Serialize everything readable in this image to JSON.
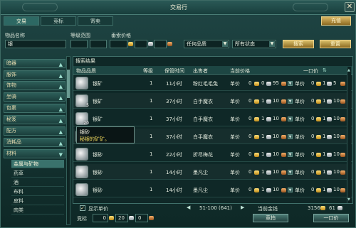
{
  "window": {
    "title": "交易行",
    "close_glyph": "✕"
  },
  "tabs": [
    {
      "label": "交易"
    },
    {
      "label": "竞标"
    },
    {
      "label": "寄卖"
    }
  ],
  "recharge_label": "充值",
  "filters": {
    "name_label": "物品名称",
    "name_value": "银",
    "level_label": "等级范围",
    "price_label": "垂索价格",
    "quality_value": "任何品质",
    "status_value": "所有状态",
    "search_label": "搜索",
    "reset_label": "重置"
  },
  "categories": [
    {
      "label": "暗器"
    },
    {
      "label": "服饰"
    },
    {
      "label": "饰物"
    },
    {
      "label": "坐骑"
    },
    {
      "label": "包裹"
    },
    {
      "label": "秘笈"
    },
    {
      "label": "配方"
    },
    {
      "label": "消耗品"
    },
    {
      "label": "材料"
    }
  ],
  "subcategories": [
    {
      "label": "金属与矿物"
    },
    {
      "label": "药草"
    },
    {
      "label": "酒"
    },
    {
      "label": "布料"
    },
    {
      "label": "皮料"
    },
    {
      "label": "肉类"
    }
  ],
  "results": {
    "caption": "搜索结果",
    "headers": {
      "quality": "物品品质",
      "level": "等级",
      "time": "保管时间",
      "seller": "出售者",
      "price": "当前价格",
      "buyout": "一口价"
    },
    "rows": [
      {
        "name": "银矿",
        "qty": "",
        "level": "1",
        "time": "11小时",
        "seller": "粉红毛毛兔",
        "unit": "单价",
        "p_g": "0",
        "p_s": "0",
        "p_c": "95",
        "b_g": "0",
        "b_s": "1",
        "b_c": "5"
      },
      {
        "name": "银矿",
        "qty": "5",
        "level": "1",
        "time": "37小时",
        "seller": "白手魔衣",
        "unit": "单价",
        "p_g": "0",
        "p_s": "1",
        "p_c": "10",
        "b_g": "0",
        "b_s": "1",
        "b_c": "10"
      },
      {
        "name": "银矿",
        "qty": "20",
        "level": "1",
        "time": "37小时",
        "seller": "白手魔衣",
        "unit": "单价",
        "p_g": "0",
        "p_s": "1",
        "p_c": "10",
        "b_g": "0",
        "b_s": "1",
        "b_c": "10"
      },
      {
        "name": "银矿",
        "qty": "20",
        "level": "1",
        "time": "37小时",
        "seller": "白手魔衣",
        "unit": "单价",
        "p_g": "0",
        "p_s": "1",
        "p_c": "10",
        "b_g": "0",
        "b_s": "1",
        "b_c": "10"
      },
      {
        "name": "银砂",
        "qty": "",
        "level": "1",
        "time": "22小时",
        "seller": "折尽梅花",
        "unit": "单价",
        "p_g": "0",
        "p_s": "1",
        "p_c": "10",
        "b_g": "0",
        "b_s": "1",
        "b_c": "10"
      },
      {
        "name": "银砂",
        "qty": "",
        "level": "1",
        "time": "14小时",
        "seller": "墨凡尘",
        "unit": "单价",
        "p_g": "0",
        "p_s": "1",
        "p_c": "10",
        "b_g": "0",
        "b_s": "1",
        "b_c": "10"
      },
      {
        "name": "银砂",
        "qty": "",
        "level": "1",
        "time": "14小时",
        "seller": "墨凡尘",
        "unit": "单价",
        "p_g": "0",
        "p_s": "1",
        "p_c": "10",
        "b_g": "0",
        "b_s": "1",
        "b_c": "10"
      }
    ]
  },
  "tooltip": {
    "line1": "银砂",
    "line2": "秘银的矿矿。"
  },
  "footer": {
    "show_unit_price_label": "显示单价",
    "checkbox_glyph": "✓",
    "page_range": "51-100 (641)",
    "prev_glyph": "◀",
    "next_glyph": "▶",
    "current_money_label": "当前金钱",
    "money_g": "3156",
    "money_s": "61",
    "bid_label": "竞标",
    "bid_g": "0",
    "bid_s": "20",
    "bid_c": "0",
    "bid_button": "竞拍",
    "buyout_button": "一口价"
  }
}
